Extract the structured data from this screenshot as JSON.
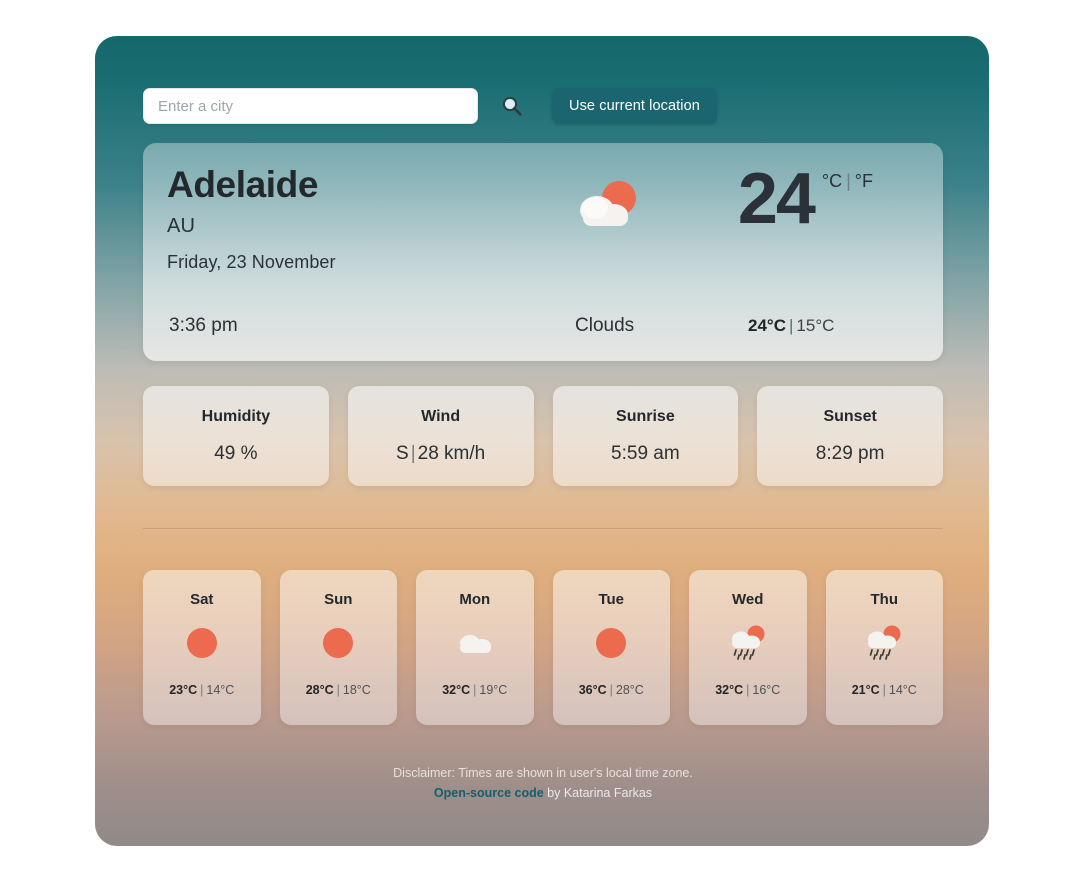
{
  "search": {
    "placeholder": "Enter a city",
    "value": "",
    "search_icon": "search-icon",
    "geolocation_label": "Use current location"
  },
  "current": {
    "city": "Adelaide",
    "country": "AU",
    "date": "Friday, 23 November",
    "time": "3:36 pm",
    "condition": "Clouds",
    "icon": "sun-behind-cloud-icon",
    "temperature": "24",
    "unit_celsius": "°C",
    "unit_separator": "|",
    "unit_fahrenheit": "°F",
    "high": "24°C",
    "low": "15°C",
    "hilo_separator": "|"
  },
  "stats": [
    {
      "label": "Humidity",
      "value": "49 %",
      "has_separator": false
    },
    {
      "label": "Wind",
      "value_left": "S",
      "separator": "|",
      "value_right": "28 km/h",
      "has_separator": true
    },
    {
      "label": "Sunrise",
      "value": "5:59 am",
      "has_separator": false
    },
    {
      "label": "Sunset",
      "value": "8:29 pm",
      "has_separator": false
    }
  ],
  "forecast": [
    {
      "day": "Sat",
      "icon": "sun-icon",
      "high": "23°C",
      "low": "14°C",
      "separator": "|"
    },
    {
      "day": "Sun",
      "icon": "sun-icon",
      "high": "28°C",
      "low": "18°C",
      "separator": "|"
    },
    {
      "day": "Mon",
      "icon": "cloud-icon",
      "high": "32°C",
      "low": "19°C",
      "separator": "|"
    },
    {
      "day": "Tue",
      "icon": "sun-icon",
      "high": "36°C",
      "low": "28°C",
      "separator": "|"
    },
    {
      "day": "Wed",
      "icon": "sun-rain-cloud-icon",
      "high": "32°C",
      "low": "16°C",
      "separator": "|"
    },
    {
      "day": "Thu",
      "icon": "sun-rain-cloud-icon",
      "high": "21°C",
      "low": "14°C",
      "separator": "|"
    }
  ],
  "footer": {
    "disclaimer": "Disclaimer: Times are shown in user's local time zone.",
    "link_text": "Open-source code",
    "credit_suffix": " by Katarina Farkas"
  },
  "colors": {
    "gradient_top": "#1A6E72",
    "gradient_mid": "#DFAE7E",
    "gradient_bottom": "#918A88",
    "button_teal": "#1B6570",
    "sun_orange": "#EC6B4E",
    "cloud_white": "#F4F3F0",
    "link_teal": "#12606E"
  }
}
